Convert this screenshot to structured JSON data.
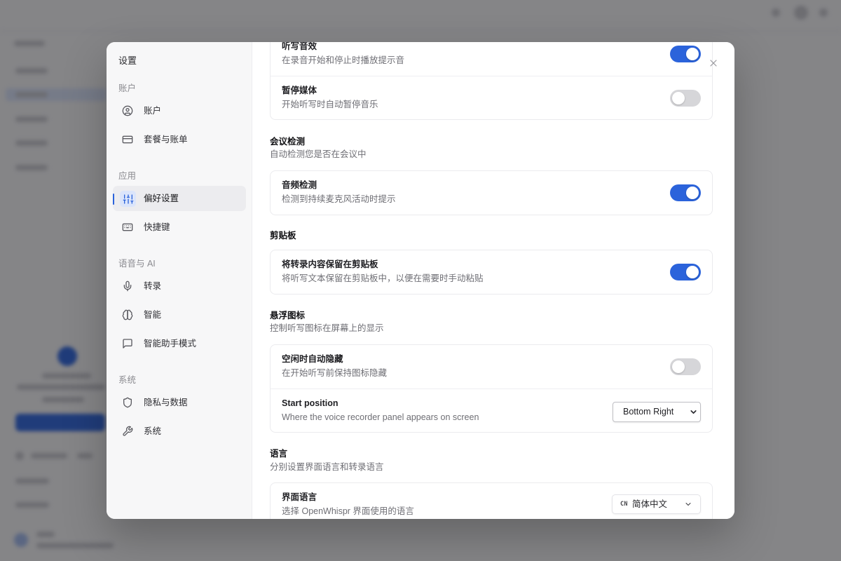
{
  "modal": {
    "title": "设置"
  },
  "sidebar": {
    "sections": [
      {
        "label": "账户",
        "items": [
          {
            "label": "账户",
            "icon": "user-circle-icon"
          },
          {
            "label": "套餐与账单",
            "icon": "credit-card-icon"
          }
        ]
      },
      {
        "label": "应用",
        "items": [
          {
            "label": "偏好设置",
            "icon": "sliders-icon",
            "active": true
          },
          {
            "label": "快捷键",
            "icon": "keyboard-icon"
          }
        ]
      },
      {
        "label": "语音与 AI",
        "items": [
          {
            "label": "转录",
            "icon": "mic-icon"
          },
          {
            "label": "智能",
            "icon": "brain-icon"
          },
          {
            "label": "智能助手模式",
            "icon": "message-square-icon"
          }
        ]
      },
      {
        "label": "系统",
        "items": [
          {
            "label": "隐私与数据",
            "icon": "shield-icon"
          },
          {
            "label": "系统",
            "icon": "wrench-icon"
          }
        ]
      }
    ]
  },
  "content": {
    "sound_feedback": {
      "rows": [
        {
          "title": "听写音效",
          "description": "在录音开始和停止时播放提示音",
          "enabled": true
        },
        {
          "title": "暂停媒体",
          "description": "开始听写时自动暂停音乐",
          "enabled": false
        }
      ]
    },
    "meeting_detection": {
      "title": "会议检测",
      "description": "自动检测您是否在会议中",
      "rows": [
        {
          "title": "音频检测",
          "description": "检测到持续麦克风活动时提示",
          "enabled": true
        }
      ]
    },
    "clipboard": {
      "title": "剪贴板",
      "rows": [
        {
          "title": "将转录内容保留在剪贴板",
          "description": "将听写文本保留在剪贴板中，以便在需要时手动粘贴",
          "enabled": true
        }
      ]
    },
    "floating_icon": {
      "title": "悬浮图标",
      "description": "控制听写图标在屏幕上的显示",
      "rows": [
        {
          "title": "空闲时自动隐藏",
          "description": "在开始听写前保持图标隐藏",
          "enabled": false
        },
        {
          "title": "Start position",
          "description": "Where the voice recorder panel appears on screen",
          "select_value": "Bottom Right"
        }
      ]
    },
    "language": {
      "title": "语言",
      "description": "分别设置界面语言和转录语言",
      "rows": [
        {
          "title": "界面语言",
          "description": "选择 OpenWhispr 界面使用的语言",
          "select_code": "CN",
          "select_value": "简体中文"
        }
      ]
    }
  },
  "colors": {
    "accent": "#2b63db",
    "toggle_off": "#d6d6d9"
  }
}
